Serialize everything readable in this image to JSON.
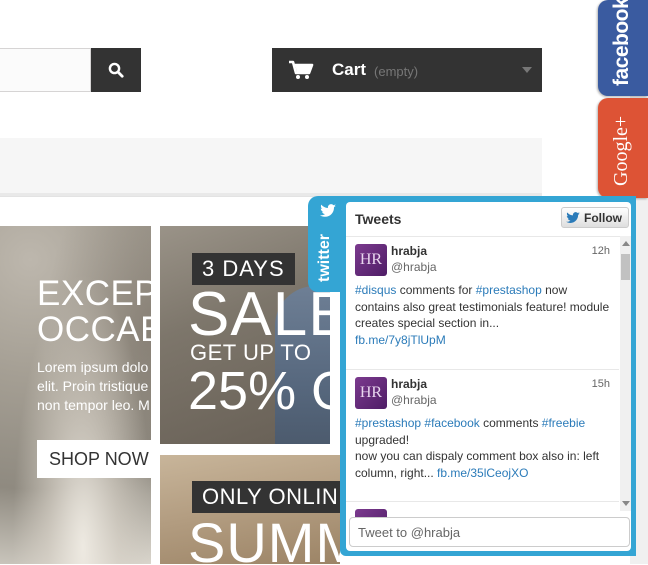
{
  "header": {
    "search": {
      "placeholder": "",
      "value": ""
    },
    "cart": {
      "label": "Cart",
      "status": "(empty)"
    }
  },
  "slider": {
    "title_line1": "EXCEP",
    "title_line2": "OCCAE",
    "text_line1": "Lorem ipsum dolo",
    "text_line2": "elit. Proin tristique",
    "text_line3": "non tempor leo. M",
    "button_label": "SHOP NOW"
  },
  "banners": [
    {
      "tag": "3 DAYS",
      "big": "SALE",
      "sub": "GET UP TO",
      "percent": "25% O"
    },
    {
      "tag": "ONLY ONLIN",
      "big": "SUMM"
    }
  ],
  "social": {
    "facebook_label": "facebook",
    "googleplus_label": "Google+",
    "twitter_label": "twitter"
  },
  "twitter_widget": {
    "title": "Tweets",
    "follow_label": "Follow",
    "tweets": [
      {
        "avatar_initials": "HR",
        "name": "hrabja",
        "handle": "@hrabja",
        "time": "12h",
        "hashtag1": "#disqus",
        "text1": " comments for ",
        "hashtag2": "#prestashop",
        "text2": " now contains also great testimonials feature! module creates special section in...",
        "link": "fb.me/7y8jTlUpM"
      },
      {
        "avatar_initials": "HR",
        "name": "hrabja",
        "handle": "@hrabja",
        "time": "15h",
        "hashtag1": "#prestashop",
        "hashtag2": "#facebook",
        "text1": " comments ",
        "hashtag3": "#freebie",
        "text2": "upgraded!",
        "text3": "now you can dispaly comment box also in: left column, right... ",
        "link": "fb.me/35lCeojXO"
      },
      {
        "avatar_initials": "HR"
      }
    ],
    "compose_placeholder": "Tweet to @hrabja"
  },
  "colors": {
    "dark": "#333333",
    "facebook": "#3a5ba0",
    "googleplus": "#dd5335",
    "twitter": "#34a5d4",
    "link": "#2b7bb9"
  }
}
